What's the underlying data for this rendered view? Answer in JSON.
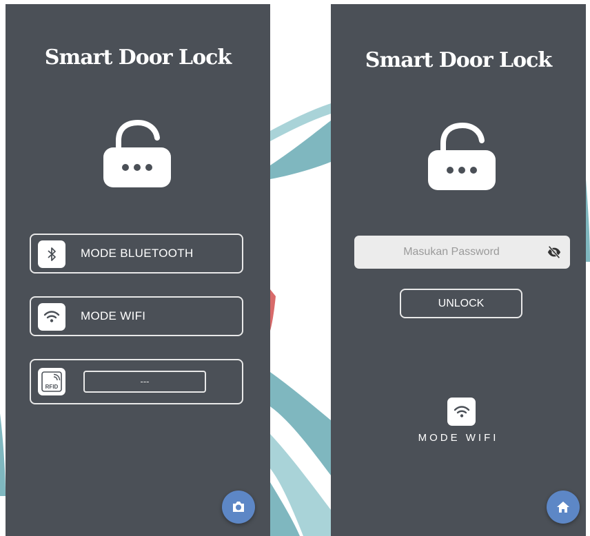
{
  "left_screen": {
    "title": "Smart Door Lock",
    "modes": [
      {
        "label": "MODE BLUETOOTH",
        "icon": "bluetooth-icon"
      },
      {
        "label": "MODE WIFI",
        "icon": "wifi-icon"
      },
      {
        "icon": "rfid-icon",
        "value": "---"
      }
    ],
    "fab_icon": "camera-icon"
  },
  "right_screen": {
    "title": "Smart Door Lock",
    "password": {
      "placeholder": "Masukan Password",
      "value": ""
    },
    "unlock_label": "UNLOCK",
    "mode_label": "MODE WIFI",
    "mode_icon": "wifi-icon",
    "fab_icon": "home-icon"
  },
  "colors": {
    "screen_bg": "#4b5057",
    "accent": "#5d87c6",
    "swirl": "#7fb7bf",
    "field_bg": "#ececec"
  }
}
